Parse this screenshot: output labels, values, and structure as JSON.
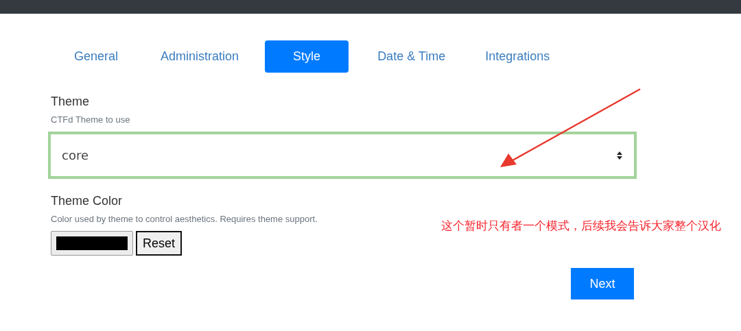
{
  "tabs": [
    {
      "label": "General",
      "selected": false
    },
    {
      "label": "Administration",
      "selected": false
    },
    {
      "label": "Style",
      "selected": true
    },
    {
      "label": "Date & Time",
      "selected": false
    },
    {
      "label": "Integrations",
      "selected": false
    }
  ],
  "theme": {
    "label": "Theme",
    "help": "CTFd Theme to use",
    "value": "core"
  },
  "theme_color": {
    "label": "Theme Color",
    "help": "Color used by theme to control aesthetics. Requires theme support.",
    "color": "#000000",
    "reset": "Reset"
  },
  "annotation": {
    "text": "这个暂时只有者一个模式，后续我会告诉大家整个汉化"
  },
  "next_button": "Next"
}
